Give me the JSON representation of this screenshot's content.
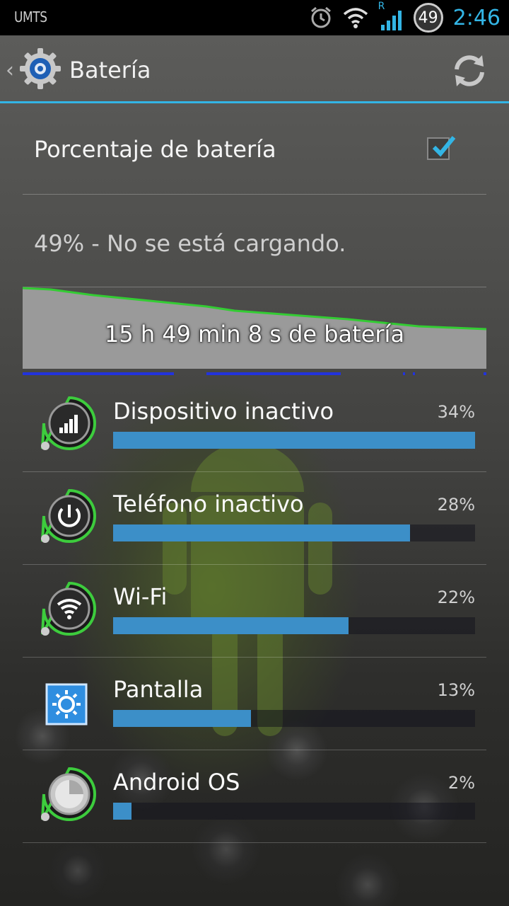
{
  "status_bar": {
    "carrier": "UMTS",
    "network_badge": "R",
    "battery_level": "49",
    "time": "2:46",
    "icons": [
      "alarm-icon",
      "wifi-icon",
      "signal-icon",
      "battery-icon"
    ]
  },
  "action_bar": {
    "title": "Batería",
    "icons": [
      "back-caret-icon",
      "settings-gear-icon",
      "refresh-icon"
    ]
  },
  "battery_percentage_pref": {
    "label": "Porcentaje de batería",
    "checked": true
  },
  "battery_status": "49% - No se está cargando.",
  "battery_graph": {
    "label": "15 h 49 min 8 s de batería",
    "line_color": "#33cc33"
  },
  "usage": [
    {
      "name": "Dispositivo inactivo",
      "percent_label": "34%",
      "fill": 1.0,
      "icon": "cell-standby-icon"
    },
    {
      "name": "Teléfono inactivo",
      "percent_label": "28%",
      "fill": 0.82,
      "icon": "phone-idle-power-icon"
    },
    {
      "name": "Wi-Fi",
      "percent_label": "22%",
      "fill": 0.65,
      "icon": "wifi-icon"
    },
    {
      "name": "Pantalla",
      "percent_label": "13%",
      "fill": 0.38,
      "icon": "screen-brightness-icon"
    },
    {
      "name": "Android OS",
      "percent_label": "2%",
      "fill": 0.05,
      "icon": "android-os-icon"
    }
  ],
  "colors": {
    "accent": "#33b5e5",
    "bar_fill": "#3c8fc8",
    "graph_line": "#33cc33",
    "graph_awake": "#2233dd"
  }
}
